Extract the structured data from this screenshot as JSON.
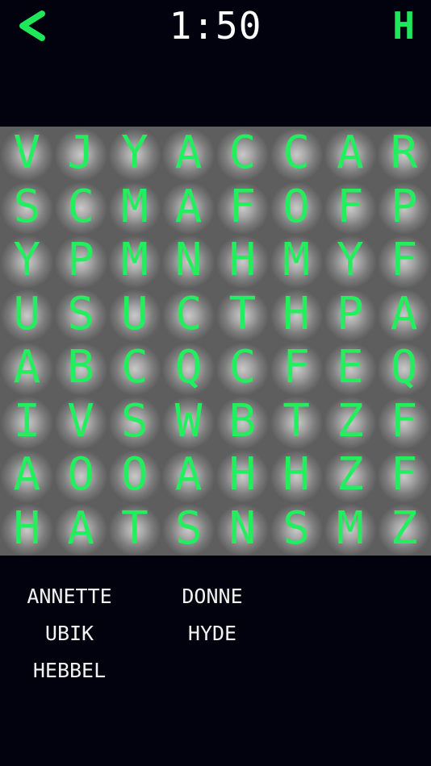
{
  "header": {
    "back_icon": "chevron-left-icon",
    "timer": "1:50",
    "hint_label": "H"
  },
  "colors": {
    "background": "#02020e",
    "board": "#5e5e5e",
    "letters": "#22ee5e",
    "words": "#f2f2f2",
    "timer": "#ffffff"
  },
  "grid": {
    "rows": [
      [
        "V",
        "J",
        "Y",
        "A",
        "C",
        "C",
        "A",
        "R"
      ],
      [
        "S",
        "C",
        "M",
        "A",
        "F",
        "O",
        "F",
        "P"
      ],
      [
        "Y",
        "P",
        "M",
        "N",
        "H",
        "M",
        "Y",
        "F"
      ],
      [
        "U",
        "S",
        "U",
        "C",
        "T",
        "H",
        "P",
        "A"
      ],
      [
        "A",
        "B",
        "C",
        "Q",
        "C",
        "F",
        "E",
        "Q"
      ],
      [
        "I",
        "V",
        "S",
        "W",
        "B",
        "T",
        "Z",
        "F"
      ],
      [
        "A",
        "O",
        "O",
        "A",
        "H",
        "H",
        "Z",
        "F"
      ],
      [
        "H",
        "A",
        "T",
        "S",
        "N",
        "S",
        "M",
        "Z"
      ]
    ]
  },
  "word_list": [
    "ANNETTE",
    "DONNE",
    "UBIK",
    "HYDE",
    "HEBBEL"
  ]
}
